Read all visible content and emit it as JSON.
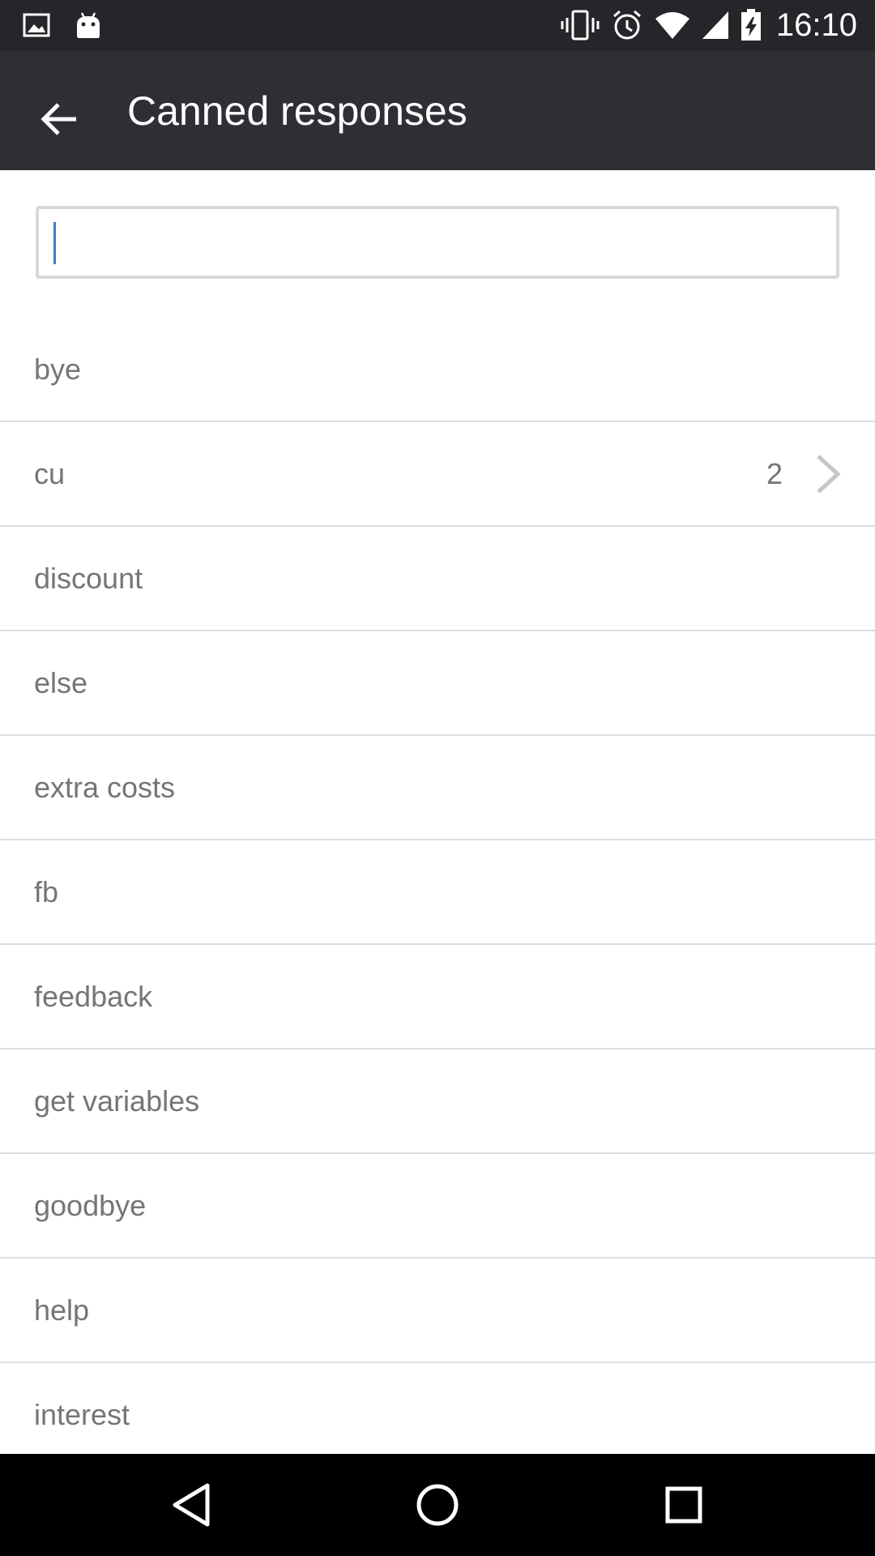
{
  "status_bar": {
    "time": "16:10",
    "left_icons": [
      "image-icon",
      "android-icon"
    ],
    "right_icons": [
      "vibrate-icon",
      "alarm-icon",
      "wifi-icon",
      "signal-icon",
      "battery-charging-icon"
    ]
  },
  "app_bar": {
    "title": "Canned responses",
    "back_icon": "arrow-back-icon"
  },
  "search": {
    "value": "",
    "placeholder": ""
  },
  "responses": [
    {
      "label": "bye",
      "count": "",
      "has_children": false
    },
    {
      "label": "cu",
      "count": "2",
      "has_children": true
    },
    {
      "label": "discount",
      "count": "",
      "has_children": false
    },
    {
      "label": "else",
      "count": "",
      "has_children": false
    },
    {
      "label": "extra costs",
      "count": "",
      "has_children": false
    },
    {
      "label": "fb",
      "count": "",
      "has_children": false
    },
    {
      "label": "feedback",
      "count": "",
      "has_children": false
    },
    {
      "label": "get variables",
      "count": "",
      "has_children": false
    },
    {
      "label": "goodbye",
      "count": "",
      "has_children": false
    },
    {
      "label": "help",
      "count": "",
      "has_children": false
    },
    {
      "label": "interest",
      "count": "",
      "has_children": false
    }
  ],
  "nav_bar": {
    "icons": [
      "nav-back-icon",
      "nav-home-icon",
      "nav-recents-icon"
    ]
  },
  "colors": {
    "status_bar": "#25262a",
    "app_bar": "#2e2f34",
    "item_text": "#757575",
    "divider": "#dddddd",
    "caret": "#3b7dc4",
    "nav_bar": "#000000"
  }
}
